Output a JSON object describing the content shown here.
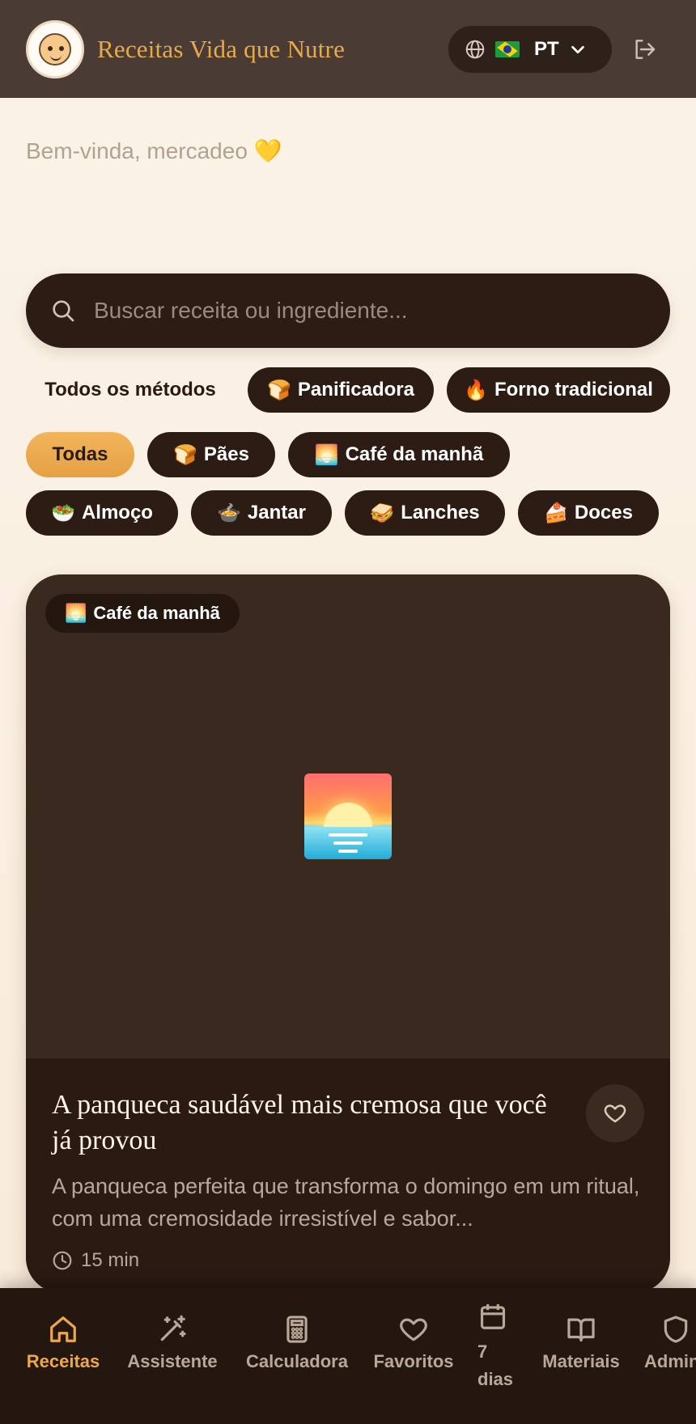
{
  "header": {
    "brand": "Receitas Vida que Nutre",
    "language_code": "PT",
    "language_flag": "brazil-flag-icon"
  },
  "welcome": "Bem-vinda, mercadeo 💛",
  "search": {
    "placeholder": "Buscar receita ou ingrediente..."
  },
  "methods": [
    {
      "label": "Todos os métodos",
      "emoji": ""
    },
    {
      "label": "Panificadora",
      "emoji": "🍞"
    },
    {
      "label": "Forno tradicional",
      "emoji": "🔥"
    }
  ],
  "categories": [
    {
      "label": "Todas",
      "emoji": "",
      "active": true
    },
    {
      "label": "Pães",
      "emoji": "🍞"
    },
    {
      "label": "Café da manhã",
      "emoji": "🌅"
    },
    {
      "label": "Almoço",
      "emoji": "🥗"
    },
    {
      "label": "Jantar",
      "emoji": "🍲"
    },
    {
      "label": "Lanches",
      "emoji": "🥪"
    },
    {
      "label": "Doces",
      "emoji": "🍰"
    }
  ],
  "recipe": {
    "badge_emoji": "🌅",
    "badge": "Café da manhã",
    "title": "A panqueca saudável mais cremosa que você já provou",
    "description": "A panqueca perfeita que transforma o domingo em um ritual, com uma cremosidade irresistível e sabor...",
    "time": "15 min"
  },
  "nav": [
    {
      "label": "Receitas",
      "icon": "home-icon",
      "active": true
    },
    {
      "label": "Assistente",
      "icon": "magic-wand-icon"
    },
    {
      "label": "Calculadora",
      "icon": "calculator-icon"
    },
    {
      "label": "Favoritos",
      "icon": "heart-icon"
    },
    {
      "label": "7 dias",
      "icon": "calendar-icon"
    },
    {
      "label": "Materiais",
      "icon": "book-icon"
    },
    {
      "label": "Admin",
      "icon": "shield-icon"
    }
  ],
  "colors": {
    "accent": "#eea84a",
    "header_bg": "#4a3c34",
    "dark": "#2c1c13"
  }
}
